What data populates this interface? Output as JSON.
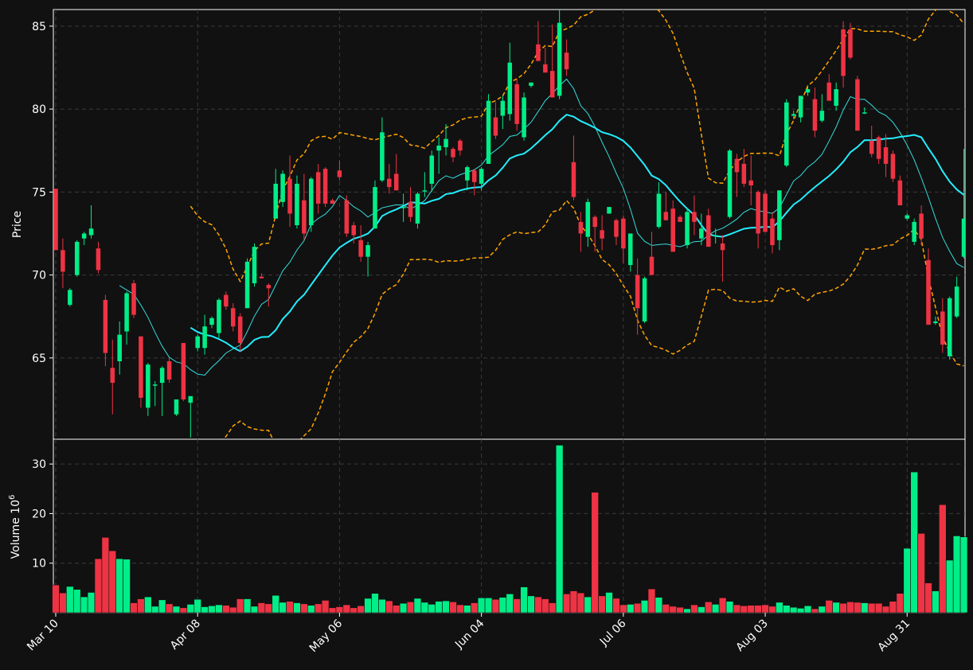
{
  "colors": {
    "background": "#111111",
    "up": "#00ee88",
    "down": "#ee3344",
    "grid": "#3a3a3a",
    "axis": "#ffffff",
    "text": "#ffffff",
    "ma_fast": "#33dddd",
    "ma_slow": "#22eeff",
    "bands": "#ffa500"
  },
  "chart_data": {
    "type": "candlestick",
    "price_axis": {
      "label": "Price",
      "ylim": [
        60.1,
        86.0
      ],
      "ticks": [
        65,
        70,
        75,
        80,
        85
      ]
    },
    "volume_axis": {
      "label": "Volume",
      "exponent_label": "6",
      "ylim": [
        0,
        35
      ],
      "ticks": [
        10,
        20,
        30
      ]
    },
    "x_tick_labels": [
      {
        "index": 0,
        "label": "Mar 10"
      },
      {
        "index": 20,
        "label": "Apr 08"
      },
      {
        "index": 40,
        "label": "May 06"
      },
      {
        "index": 60,
        "label": "Jun 04"
      },
      {
        "index": 80,
        "label": "Jul 06"
      },
      {
        "index": 100,
        "label": "Aug 03"
      },
      {
        "index": 120,
        "label": "Aug 31"
      }
    ],
    "grid": true,
    "candles": [
      [
        75.2,
        75.2,
        71.5,
        71.5,
        5.6
      ],
      [
        71.5,
        72.2,
        69.2,
        70.2,
        4.0
      ],
      [
        68.2,
        69.2,
        68.1,
        69.1,
        5.3
      ],
      [
        70.0,
        72.1,
        69.9,
        72.0,
        4.7
      ],
      [
        72.2,
        72.6,
        71.8,
        72.5,
        3.2
      ],
      [
        72.4,
        74.2,
        72.2,
        72.8,
        4.1
      ],
      [
        71.6,
        72.0,
        70.1,
        70.3,
        10.9
      ],
      [
        68.5,
        68.8,
        64.5,
        65.3,
        15.2
      ],
      [
        64.4,
        66.1,
        61.6,
        63.5,
        12.5
      ],
      [
        64.8,
        67.2,
        64.0,
        66.4,
        10.9
      ],
      [
        66.6,
        69.0,
        65.8,
        68.9,
        10.8
      ],
      [
        69.5,
        69.7,
        67.4,
        67.6,
        2.0
      ],
      [
        66.3,
        66.3,
        62.0,
        62.6,
        2.8
      ],
      [
        62.0,
        64.7,
        61.5,
        64.6,
        3.2
      ],
      [
        63.4,
        63.6,
        62.1,
        63.4,
        1.3
      ],
      [
        63.5,
        64.5,
        61.5,
        64.4,
        2.6
      ],
      [
        64.8,
        65.0,
        63.5,
        63.7,
        1.8
      ],
      [
        61.6,
        62.5,
        61.5,
        62.5,
        1.3
      ],
      [
        65.9,
        65.9,
        62.4,
        62.5,
        1.0
      ],
      [
        62.3,
        62.7,
        60.2,
        62.7,
        1.7
      ],
      [
        65.6,
        66.4,
        65.4,
        66.3,
        2.7
      ],
      [
        65.6,
        67.6,
        65.2,
        66.9,
        1.2
      ],
      [
        67.0,
        67.5,
        66.8,
        67.4,
        1.4
      ],
      [
        66.5,
        68.6,
        66.2,
        68.5,
        1.6
      ],
      [
        68.8,
        69.0,
        67.9,
        68.1,
        1.5
      ],
      [
        68.0,
        68.3,
        66.6,
        66.9,
        1.1
      ],
      [
        67.5,
        67.7,
        65.4,
        65.9,
        2.8
      ],
      [
        68.0,
        71.0,
        68.0,
        70.8,
        2.8
      ],
      [
        69.5,
        71.9,
        69.3,
        71.7,
        1.3
      ],
      [
        69.9,
        70.1,
        69.8,
        69.8,
        2.0
      ],
      [
        69.4,
        69.5,
        68.1,
        69.2,
        1.8
      ],
      [
        73.4,
        76.4,
        73.4,
        75.5,
        3.5
      ],
      [
        74.4,
        76.3,
        74.1,
        76.1,
        2.1
      ],
      [
        75.8,
        77.2,
        72.9,
        73.7,
        2.3
      ],
      [
        73.0,
        76.0,
        72.8,
        75.5,
        2.0
      ],
      [
        74.5,
        76.1,
        72.1,
        72.5,
        1.8
      ],
      [
        73.0,
        75.9,
        72.6,
        75.8,
        1.5
      ],
      [
        76.2,
        76.7,
        73.7,
        74.3,
        1.8
      ],
      [
        76.4,
        76.5,
        74.1,
        74.3,
        2.5
      ],
      [
        74.5,
        74.6,
        74.3,
        74.3,
        1.0
      ],
      [
        76.3,
        76.9,
        75.7,
        75.9,
        1.2
      ],
      [
        74.5,
        74.8,
        72.3,
        72.5,
        1.6
      ],
      [
        73.0,
        73.2,
        71.9,
        72.4,
        1.0
      ],
      [
        72.1,
        73.0,
        70.8,
        71.1,
        1.4
      ],
      [
        71.1,
        72.0,
        69.9,
        71.8,
        2.9
      ],
      [
        72.8,
        75.7,
        72.8,
        75.3,
        3.9
      ],
      [
        75.7,
        79.5,
        75.6,
        78.6,
        2.7
      ],
      [
        75.8,
        76.7,
        74.9,
        75.3,
        2.4
      ],
      [
        76.1,
        77.3,
        75.4,
        75.1,
        1.5
      ],
      [
        74.1,
        74.9,
        73.2,
        74.1,
        1.9
      ],
      [
        74.4,
        75.3,
        73.2,
        73.5,
        2.2
      ],
      [
        73.1,
        75.0,
        72.8,
        74.9,
        2.9
      ],
      [
        75.1,
        76.2,
        74.7,
        75.1,
        2.1
      ],
      [
        75.5,
        77.5,
        75.0,
        77.2,
        1.7
      ],
      [
        77.5,
        78.3,
        76.1,
        77.8,
        2.3
      ],
      [
        77.7,
        79.1,
        77.2,
        78.2,
        2.4
      ],
      [
        77.6,
        77.7,
        76.8,
        77.1,
        2.2
      ],
      [
        78.1,
        78.2,
        77.2,
        77.5,
        1.6
      ],
      [
        75.7,
        76.6,
        75.1,
        76.5,
        1.5
      ],
      [
        76.3,
        76.4,
        74.8,
        75.6,
        2.0
      ],
      [
        75.5,
        76.5,
        75.1,
        76.4,
        3.0
      ],
      [
        76.7,
        80.9,
        76.7,
        80.5,
        3.0
      ],
      [
        79.5,
        80.4,
        78.2,
        78.4,
        2.7
      ],
      [
        79.6,
        80.8,
        78.8,
        80.5,
        3.1
      ],
      [
        79.7,
        84.0,
        79.3,
        82.8,
        3.8
      ],
      [
        81.5,
        81.8,
        78.7,
        79.1,
        2.8
      ],
      [
        78.3,
        81.0,
        78.1,
        80.7,
        5.2
      ],
      [
        81.4,
        81.6,
        81.3,
        81.6,
        3.4
      ],
      [
        83.9,
        85.3,
        82.9,
        82.9,
        3.2
      ],
      [
        82.7,
        83.7,
        82.3,
        82.2,
        2.8
      ],
      [
        82.3,
        85.1,
        80.8,
        80.7,
        2.0
      ],
      [
        80.8,
        86.0,
        80.6,
        85.2,
        33.8
      ],
      [
        83.4,
        84.2,
        82.0,
        82.4,
        3.8
      ],
      [
        76.8,
        78.4,
        74.5,
        74.7,
        4.4
      ],
      [
        73.2,
        73.8,
        71.4,
        72.5,
        4.0
      ],
      [
        72.3,
        74.6,
        71.7,
        74.4,
        3.2
      ],
      [
        73.5,
        73.6,
        71.4,
        72.9,
        24.3
      ],
      [
        72.7,
        73.6,
        71.5,
        72.2,
        3.4
      ],
      [
        73.7,
        74.1,
        73.7,
        74.1,
        4.1
      ],
      [
        73.3,
        73.4,
        71.8,
        72.3,
        2.9
      ],
      [
        73.4,
        73.6,
        70.7,
        71.6,
        1.6
      ],
      [
        70.6,
        72.5,
        70.2,
        72.5,
        1.7
      ],
      [
        70.0,
        71.0,
        66.4,
        68.0,
        1.9
      ],
      [
        67.2,
        69.9,
        67.1,
        69.8,
        2.5
      ],
      [
        71.1,
        72.6,
        70.1,
        70.0,
        4.8
      ],
      [
        72.9,
        75.6,
        72.8,
        74.9,
        3.1
      ],
      [
        73.8,
        75.0,
        73.3,
        73.3,
        1.7
      ],
      [
        74.0,
        74.5,
        71.9,
        71.4,
        1.3
      ],
      [
        73.5,
        73.6,
        73.2,
        73.2,
        1.1
      ],
      [
        71.8,
        74.0,
        71.6,
        73.8,
        0.8
      ],
      [
        73.8,
        74.8,
        72.4,
        73.2,
        1.6
      ],
      [
        72.2,
        73.7,
        71.8,
        72.8,
        1.2
      ],
      [
        73.6,
        74.0,
        72.0,
        71.7,
        2.2
      ],
      [
        72.4,
        72.8,
        71.9,
        72.4,
        1.7
      ],
      [
        71.9,
        72.4,
        69.6,
        71.5,
        3.0
      ],
      [
        73.5,
        77.6,
        73.4,
        77.5,
        2.3
      ],
      [
        77.0,
        77.3,
        74.7,
        76.2,
        1.6
      ],
      [
        76.7,
        77.6,
        75.3,
        75.5,
        1.4
      ],
      [
        75.7,
        77.2,
        74.2,
        75.4,
        1.5
      ],
      [
        75.0,
        75.1,
        71.6,
        72.5,
        1.5
      ],
      [
        74.9,
        75.1,
        72.7,
        72.6,
        1.6
      ],
      [
        73.4,
        73.8,
        71.3,
        71.8,
        1.3
      ],
      [
        72.1,
        75.0,
        71.5,
        75.1,
        2.1
      ],
      [
        76.6,
        80.6,
        76.5,
        80.4,
        1.5
      ],
      [
        79.6,
        79.9,
        79.4,
        79.7,
        1.1
      ],
      [
        79.5,
        80.6,
        79.2,
        80.8,
        0.9
      ],
      [
        81.0,
        81.4,
        80.8,
        81.2,
        1.4
      ],
      [
        80.6,
        81.3,
        78.3,
        78.7,
        0.8
      ],
      [
        79.3,
        80.9,
        79.2,
        79.9,
        1.3
      ],
      [
        81.6,
        82.1,
        81.0,
        80.5,
        2.5
      ],
      [
        80.2,
        81.6,
        79.9,
        81.2,
        2.1
      ],
      [
        84.8,
        85.3,
        81.3,
        82.0,
        1.9
      ],
      [
        84.8,
        85.2,
        83.0,
        83.1,
        2.2
      ],
      [
        81.8,
        82.0,
        78.7,
        78.7,
        2.1
      ],
      [
        79.8,
        80.1,
        79.7,
        79.8,
        2.0
      ],
      [
        78.1,
        79.0,
        77.1,
        77.3,
        1.9
      ],
      [
        78.3,
        78.4,
        76.7,
        77.0,
        1.9
      ],
      [
        77.7,
        78.5,
        75.9,
        76.7,
        1.3
      ],
      [
        77.3,
        77.5,
        75.6,
        75.8,
        2.3
      ],
      [
        75.7,
        76.0,
        74.2,
        74.2,
        3.9
      ],
      [
        73.4,
        73.7,
        73.3,
        73.6,
        13.0
      ],
      [
        72.0,
        73.4,
        71.8,
        73.2,
        28.4
      ],
      [
        73.7,
        74.2,
        71.8,
        72.2,
        16.0
      ],
      [
        70.9,
        71.6,
        67.1,
        67.0,
        6.0
      ],
      [
        67.1,
        67.5,
        67.0,
        67.2,
        4.4
      ],
      [
        67.8,
        68.6,
        65.3,
        65.8,
        21.8
      ],
      [
        65.1,
        68.7,
        64.9,
        68.6,
        10.6
      ],
      [
        67.5,
        69.9,
        67.4,
        69.3,
        15.5
      ],
      [
        71.1,
        77.6,
        71.0,
        73.4,
        15.3
      ]
    ]
  }
}
